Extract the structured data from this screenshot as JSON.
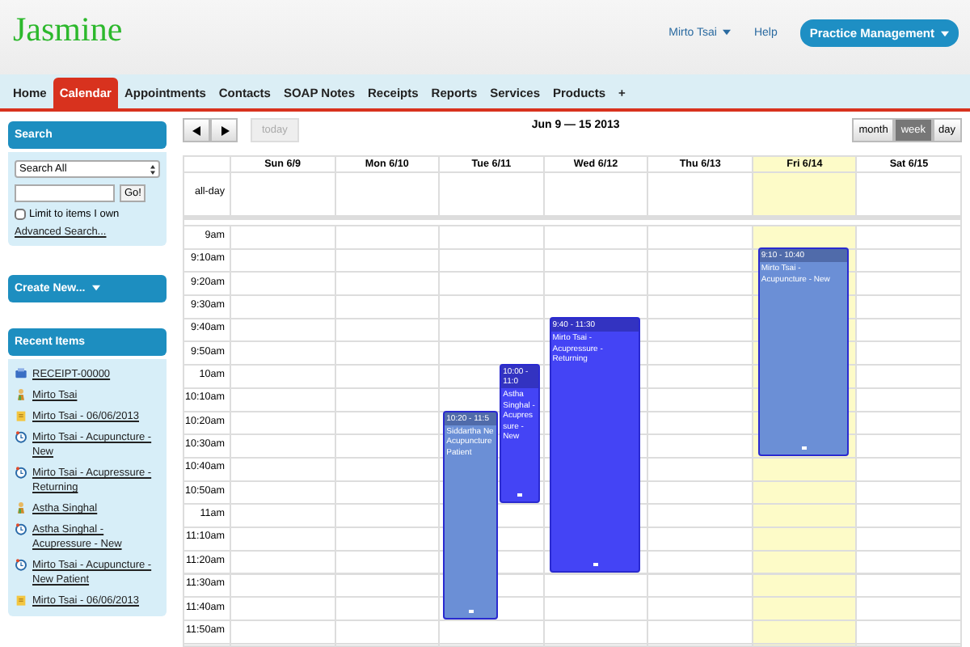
{
  "header": {
    "logo": "Jasmine",
    "user_menu": "Mirto Tsai",
    "help": "Help",
    "app_menu": "Practice Management"
  },
  "tabs": [
    {
      "label": "Home",
      "selected": false
    },
    {
      "label": "Calendar",
      "selected": true
    },
    {
      "label": "Appointments",
      "selected": false
    },
    {
      "label": "Contacts",
      "selected": false
    },
    {
      "label": "SOAP Notes",
      "selected": false
    },
    {
      "label": "Receipts",
      "selected": false
    },
    {
      "label": "Reports",
      "selected": false
    },
    {
      "label": "Services",
      "selected": false
    },
    {
      "label": "Products",
      "selected": false
    },
    {
      "label": "+",
      "selected": false
    }
  ],
  "sidebar": {
    "search": {
      "title": "Search",
      "scope": "Search All",
      "go": "Go!",
      "limit_label": "Limit to items I own",
      "limit_checked": false,
      "advanced": "Advanced Search..."
    },
    "create": "Create New...",
    "recent_title": "Recent Items",
    "recent_items": [
      {
        "kind": "receipt",
        "label": "RECEIPT-00000"
      },
      {
        "kind": "contact",
        "label": "Mirto Tsai"
      },
      {
        "kind": "note",
        "label": "Mirto Tsai - 06/06/2013"
      },
      {
        "kind": "appointment",
        "label": "Mirto Tsai - Acupuncture - New"
      },
      {
        "kind": "appointment",
        "label": "Mirto Tsai - Acupressure - Returning"
      },
      {
        "kind": "contact",
        "label": "Astha Singhal"
      },
      {
        "kind": "appointment",
        "label": "Astha Singhal - Acupressure - New"
      },
      {
        "kind": "appointment",
        "label": "Mirto Tsai - Acupuncture - New Patient"
      },
      {
        "kind": "note",
        "label": "Mirto Tsai - 06/06/2013"
      }
    ]
  },
  "calendar": {
    "title": "Jun 9 — 15 2013",
    "today": "today",
    "views": [
      {
        "label": "month",
        "selected": false
      },
      {
        "label": "week",
        "selected": true
      },
      {
        "label": "day",
        "selected": false
      }
    ],
    "all_day_label": "all-day",
    "times": [
      "9am",
      "9:10am",
      "9:20am",
      "9:30am",
      "9:40am",
      "9:50am",
      "10am",
      "10:10am",
      "10:20am",
      "10:30am",
      "10:40am",
      "10:50am",
      "11am",
      "11:10am",
      "11:20am",
      "11:30am",
      "11:40am",
      "11:50am"
    ],
    "days": [
      {
        "label": "Sun 6/9",
        "today": false
      },
      {
        "label": "Mon 6/10",
        "today": false
      },
      {
        "label": "Tue 6/11",
        "today": false,
        "events": [
          {
            "time": "10:20 - 11:5",
            "title": "Siddartha Ne Acupuncture Patient",
            "color": "#6b8fd6"
          },
          {
            "time": "10:00 - 11:0",
            "title": "Astha Singhal - Acupressure - New",
            "color": "#4444f5"
          }
        ]
      },
      {
        "label": "Wed 6/12",
        "today": false,
        "events": [
          {
            "time": "9:40 - 11:30",
            "title": "Mirto Tsai - Acupressure - Returning",
            "color": "#4444f5"
          }
        ]
      },
      {
        "label": "Thu 6/13",
        "today": false
      },
      {
        "label": "Fri 6/14",
        "today": true,
        "events": [
          {
            "time": "9:10 - 10:40",
            "title": "Mirto Tsai - Acupuncture - New",
            "color": "#6b8fd6"
          }
        ]
      },
      {
        "label": "Sat 6/15",
        "today": false
      }
    ]
  }
}
